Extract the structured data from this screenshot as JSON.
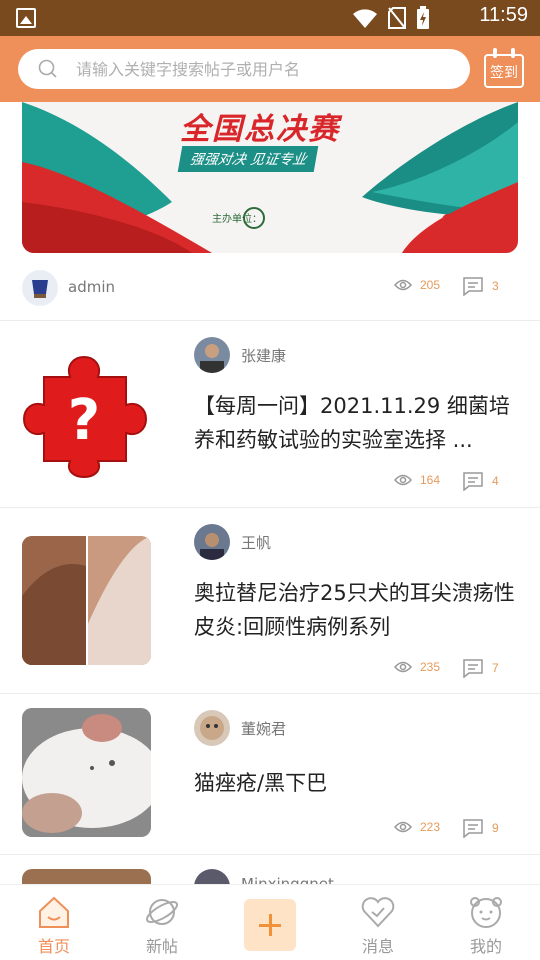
{
  "status_bar": {
    "time": "11:59"
  },
  "header": {
    "search_placeholder": "请输入关键字搜索帖子或用户名",
    "checkin_label": "签到"
  },
  "banner": {
    "title": "全国总决赛",
    "subtitle": "强强对决 见证专业",
    "sponsor_label": "主办单位："
  },
  "first_post_meta": {
    "author": "admin",
    "views": "205",
    "comments": "3"
  },
  "posts": [
    {
      "author": "张建康",
      "title": "【每周一问】2021.11.29 细菌培养和药敏试验的实验室选择 ...",
      "views": "164",
      "comments": "4"
    },
    {
      "author": "王帆",
      "title": "奥拉替尼治疗25只犬的耳尖溃疡性皮炎:回顾性病例系列",
      "views": "235",
      "comments": "7"
    },
    {
      "author": "董婉君",
      "title": "猫痤疮/黑下巴",
      "views": "223",
      "comments": "9"
    },
    {
      "author": "Minxinggnet"
    }
  ],
  "bottom_nav": {
    "items": [
      {
        "label": "首页",
        "icon": "home-icon",
        "active": true
      },
      {
        "label": "新帖",
        "icon": "planet-icon",
        "active": false
      },
      {
        "label": "消息",
        "icon": "heart-icon",
        "active": false
      },
      {
        "label": "我的",
        "icon": "bear-face-icon",
        "active": false
      }
    ]
  },
  "colors": {
    "status_bar": "#7a4a1f",
    "header": "#ef8f59",
    "accent": "#ef8f59",
    "stat_text": "#e69a5a"
  }
}
